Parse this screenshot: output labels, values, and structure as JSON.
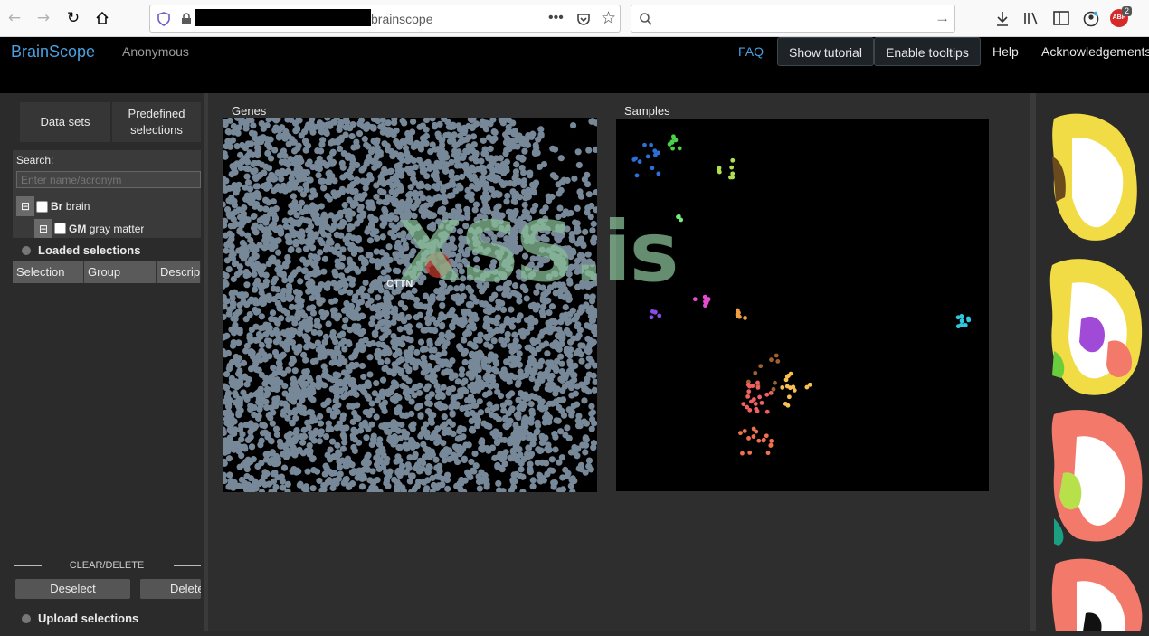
{
  "browser": {
    "url_suffix": "brainscope",
    "toolbar_icons": [
      "back-icon",
      "forward-icon",
      "reload-icon",
      "home-icon",
      "shield-icon",
      "lock-icon",
      "more-icon",
      "pocket-icon",
      "star-icon",
      "search-icon",
      "go-arrow-icon",
      "download-icon",
      "library-icon",
      "sidebar-icon",
      "account-icon",
      "abp-icon"
    ],
    "abp_badge": "2",
    "abp_label": "ABP"
  },
  "header": {
    "brand": "BrainScope",
    "user": "Anonymous",
    "faq": "FAQ",
    "show_tutorial": "Show tutorial",
    "enable_tooltips": "Enable tooltips",
    "help": "Help",
    "acknowledgements": "Acknowledgements"
  },
  "sidebar": {
    "tabs": [
      "Data sets",
      "Predefined selections"
    ],
    "search_label": "Search:",
    "search_placeholder": "Enter name/acronym",
    "tree": [
      {
        "toggle": "⊟",
        "acronym": "Br",
        "name": "brain"
      },
      {
        "toggle": "⊟",
        "acronym": "GM",
        "name": "gray matter"
      }
    ],
    "loaded_selections": "Loaded selections",
    "table_headers": [
      "Selection",
      "Group",
      "Descrip"
    ],
    "clear_delete": "CLEAR/DELETE",
    "deselect": "Deselect",
    "delete": "Delete",
    "upload_selections": "Upload selections"
  },
  "genes_panel": {
    "title": "Genes",
    "highlight_gene": "CTTN",
    "point_color": "#778899"
  },
  "samples_panel": {
    "title": "Samples"
  },
  "watermark": "XSS.is",
  "colors": {
    "brand": "#4aa0e0",
    "header_bg": "#000000",
    "highlight": "#c0392b"
  }
}
